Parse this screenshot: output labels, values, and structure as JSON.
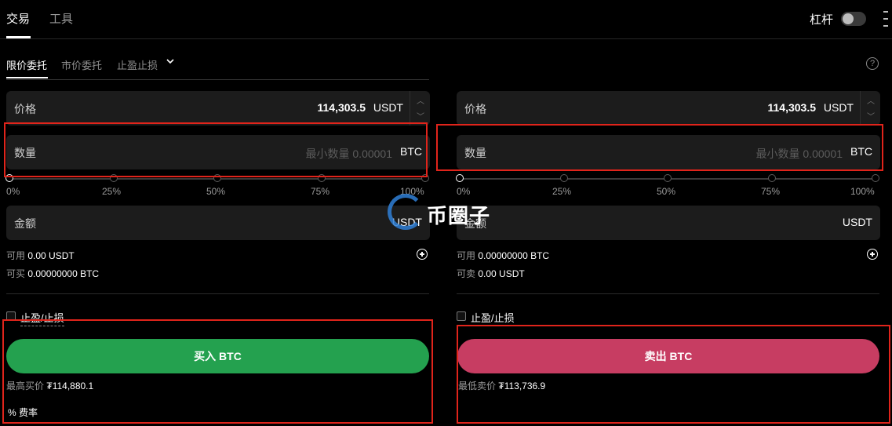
{
  "top_tabs": [
    "交易",
    "工具"
  ],
  "leverage_label": "杠杆",
  "order_tabs": [
    "限价委托",
    "市价委托",
    "止盈止损"
  ],
  "buy": {
    "price_label": "价格",
    "price_value": "114,303.5",
    "price_unit": "USDT",
    "qty_label": "数量",
    "qty_placeholder": "最小数量 0.00001",
    "qty_unit": "BTC",
    "slider_labels": [
      "0%",
      "25%",
      "50%",
      "75%",
      "100%"
    ],
    "amount_label": "金额",
    "amount_unit": "USDT",
    "available_label": "可用",
    "available_value": "0.00 USDT",
    "can_buy_label": "可买",
    "can_buy_value": "0.00000000 BTC",
    "tpsl_label": "止盈/止损",
    "button_label": "买入 BTC",
    "best_label": "最高买价",
    "best_value": "₮114,880.1",
    "fee_label": "% 费率"
  },
  "sell": {
    "price_label": "价格",
    "price_value": "114,303.5",
    "price_unit": "USDT",
    "qty_label": "数量",
    "qty_placeholder": "最小数量 0.00001",
    "qty_unit": "BTC",
    "slider_labels": [
      "0%",
      "25%",
      "50%",
      "75%",
      "100%"
    ],
    "amount_label": "金额",
    "amount_unit": "USDT",
    "available_label": "可用",
    "available_value": "0.00000000 BTC",
    "can_sell_label": "可卖",
    "can_sell_value": "0.00 USDT",
    "tpsl_label": "止盈/止损",
    "button_label": "卖出 BTC",
    "best_label": "最低卖价",
    "best_value": "₮113,736.9"
  },
  "watermark": "币圈子",
  "colors": {
    "buy": "#24a14f",
    "sell": "#c73d62",
    "highlight": "#e0241b"
  }
}
